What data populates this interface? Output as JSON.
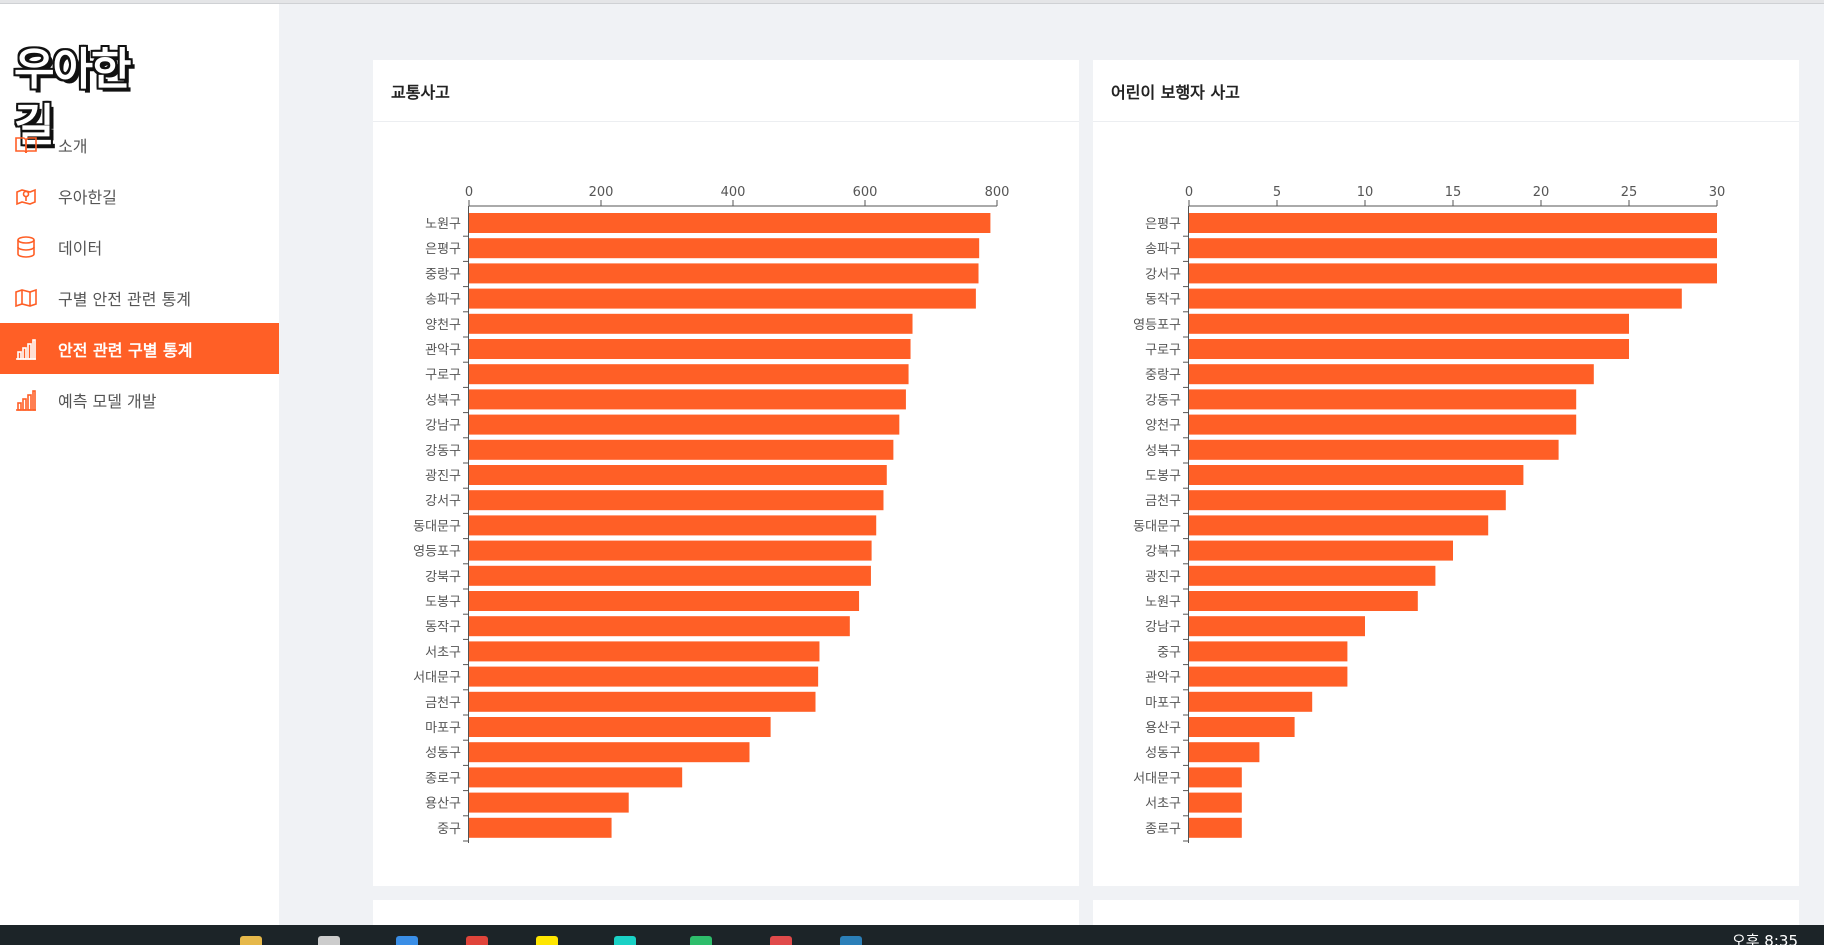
{
  "app": {
    "logo_text": "우아한길",
    "accent_color": "#ff5f26"
  },
  "sidebar": {
    "items": [
      {
        "label": "소개",
        "icon": "book-icon",
        "active": false
      },
      {
        "label": "우아한길",
        "icon": "map-pin-icon",
        "active": false
      },
      {
        "label": "데이터",
        "icon": "database-icon",
        "active": false
      },
      {
        "label": "구별 안전 관련 통계",
        "icon": "map-icon",
        "active": false
      },
      {
        "label": "안전 관련 구별 통계",
        "icon": "bar-chart-icon",
        "active": true
      },
      {
        "label": "예측 모델 개발",
        "icon": "bar-chart-icon",
        "active": false
      }
    ]
  },
  "cards": [
    {
      "title": "교통사고"
    },
    {
      "title": "어린이 보행자 사고"
    }
  ],
  "chart_data": [
    {
      "type": "bar",
      "orientation": "horizontal",
      "title": "",
      "categories": [
        "노원구",
        "은평구",
        "중랑구",
        "송파구",
        "양천구",
        "관악구",
        "구로구",
        "성북구",
        "강남구",
        "강동구",
        "광진구",
        "강서구",
        "동대문구",
        "영등포구",
        "강북구",
        "도봉구",
        "동작구",
        "서초구",
        "서대문구",
        "금천구",
        "마포구",
        "성동구",
        "종로구",
        "용산구",
        "중구"
      ],
      "values": [
        790,
        773,
        772,
        768,
        672,
        669,
        666,
        662,
        652,
        643,
        633,
        628,
        617,
        610,
        609,
        591,
        577,
        531,
        529,
        525,
        457,
        425,
        323,
        242,
        216
      ],
      "xlim": [
        0,
        800
      ],
      "xticks": [
        0,
        200,
        400,
        600,
        800
      ],
      "axis_position": "top",
      "bar_color": "#ff5f26"
    },
    {
      "type": "bar",
      "orientation": "horizontal",
      "title": "",
      "categories": [
        "은평구",
        "송파구",
        "강서구",
        "동작구",
        "영등포구",
        "구로구",
        "중랑구",
        "강동구",
        "양천구",
        "성북구",
        "도봉구",
        "금천구",
        "동대문구",
        "강북구",
        "광진구",
        "노원구",
        "강남구",
        "중구",
        "관악구",
        "마포구",
        "용산구",
        "성동구",
        "서대문구",
        "서초구",
        "종로구"
      ],
      "values": [
        30,
        30,
        30,
        28,
        25,
        25,
        23,
        22,
        22,
        21,
        19,
        18,
        17,
        15,
        14,
        13,
        10,
        9,
        9,
        7,
        6,
        4,
        3,
        3,
        3
      ],
      "xlim": [
        0,
        30
      ],
      "xticks": [
        0,
        5,
        10,
        15,
        20,
        25,
        30
      ],
      "axis_position": "top",
      "bar_color": "#ff5f26"
    }
  ],
  "taskbar": {
    "clock": "오후 8:35"
  }
}
